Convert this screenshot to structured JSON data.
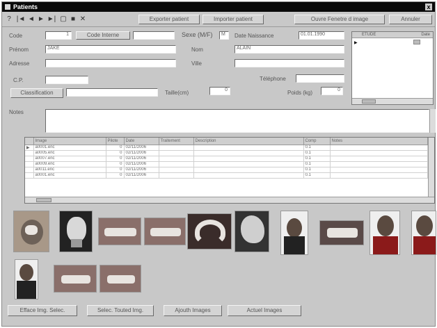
{
  "window": {
    "title": "Patients",
    "close_glyph": "x"
  },
  "toolbar": {
    "icons": [
      "help-icon",
      "first-record-icon",
      "prev-record-icon",
      "next-record-icon",
      "last-record-icon",
      "new-record-icon",
      "save-icon",
      "delete-icon"
    ],
    "glyphs": [
      "?",
      "|◄",
      "◄",
      "►",
      "►|",
      "▢",
      "■",
      "✕"
    ],
    "buttons": [
      "Exporter patient",
      "Importer patient",
      "Ouvre Fenetre d image",
      "Annuler"
    ]
  },
  "form": {
    "code_label": "Code",
    "code_value": "1",
    "code_interne_label": "Code Interne",
    "code_interne_value": "",
    "sexe_label": "Sexe (M/F)",
    "sexe_value": "M",
    "date_naissance_label": "Date Naissance",
    "date_naissance_value": "01.01.1990",
    "prenom_label": "Prénom",
    "prenom_value": "JAKE",
    "nom_label": "Nom",
    "nom_value": "ALAIN",
    "adresse_label": "Adresse",
    "adresse_value": "",
    "ville_label": "Ville",
    "ville_value": "",
    "cp_label": "C.P.",
    "cp_value": "",
    "telephone_label": "Téléphone",
    "telephone_value": "",
    "classification_button": "Classification",
    "classification_value": "",
    "taille_label": "Taille(cm)",
    "taille_value": "0",
    "poids_label": "Poids (kg)",
    "poids_value": "0",
    "notes_label": "Notes",
    "notes_value": ""
  },
  "side_panel": {
    "col1": "ETUDE",
    "col2": "Date"
  },
  "grid": {
    "columns": [
      "Image",
      "Pilote",
      "Date",
      "Traitement",
      "Description",
      "Comp",
      "Notes"
    ],
    "rows": [
      {
        "image": "a0001.enc",
        "pilote": "0",
        "date": "02/11/2006",
        "comp": "0.1"
      },
      {
        "image": "a0005.enc",
        "pilote": "0",
        "date": "02/11/2006",
        "comp": "0.1"
      },
      {
        "image": "a0007.enc",
        "pilote": "0",
        "date": "02/11/2006",
        "comp": "0.1"
      },
      {
        "image": "a0009.enc",
        "pilote": "0",
        "date": "02/11/2006",
        "comp": "0.1"
      },
      {
        "image": "a0011.enc",
        "pilote": "0",
        "date": "02/11/2006",
        "comp": "0.1"
      },
      {
        "image": "a0001.enc",
        "pilote": "0",
        "date": "02/11/2006",
        "comp": "0.1"
      }
    ]
  },
  "thumbnails": [
    {
      "name": "intraoral-photo"
    },
    {
      "name": "xray-frontal"
    },
    {
      "name": "teeth-occlusion-right"
    },
    {
      "name": "teeth-occlusion-left"
    },
    {
      "name": "upper-arch"
    },
    {
      "name": "xray-lateral"
    },
    {
      "name": "profile-photo"
    },
    {
      "name": "teeth-frontal"
    },
    {
      "name": "face-frontal"
    },
    {
      "name": "face-smile"
    },
    {
      "name": "profile-photo-2"
    },
    {
      "name": "teeth-frontal-2"
    },
    {
      "name": "teeth-frontal-3"
    }
  ],
  "bottom_buttons": [
    "Efface Img. Selec.",
    "Selec. Touted Img.",
    "Ajouth Images",
    "Actuel Images"
  ]
}
